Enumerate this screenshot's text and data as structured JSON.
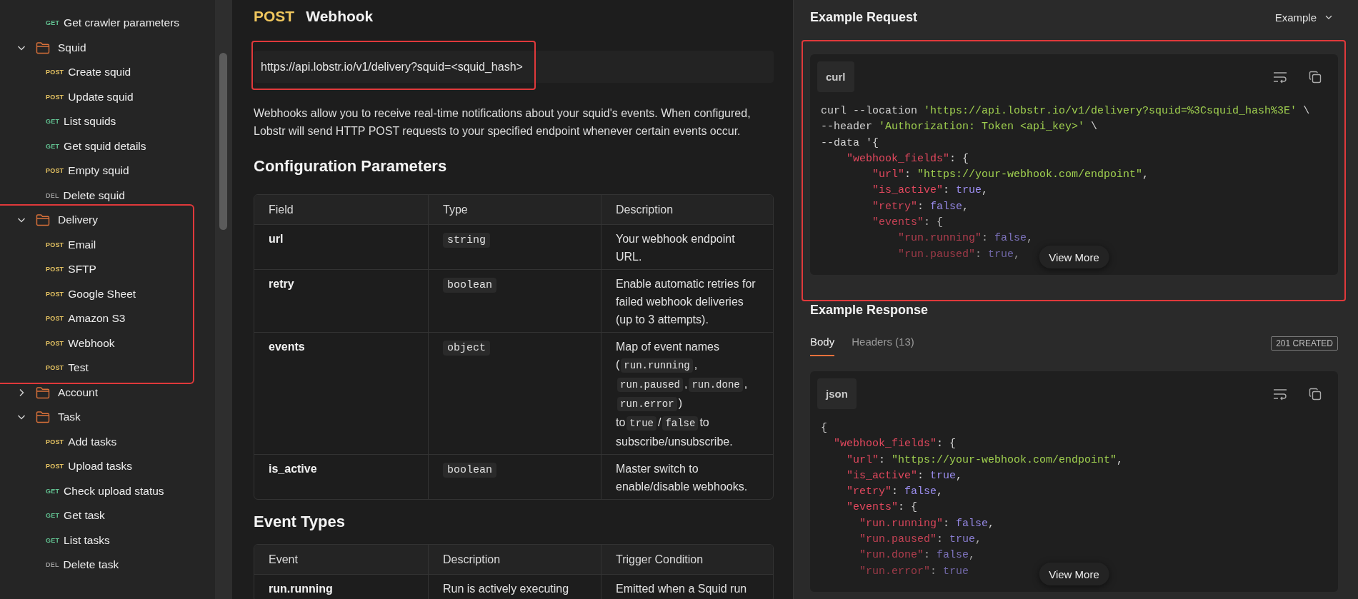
{
  "sidebar": {
    "items": [
      {
        "kind": "get",
        "method": "GET",
        "label": "Get crawler parameters"
      },
      {
        "kind": "folder",
        "label": "Squid",
        "expanded": true,
        "highlighted": false,
        "children": [
          {
            "kind": "post",
            "method": "POST",
            "label": "Create squid"
          },
          {
            "kind": "post",
            "method": "POST",
            "label": "Update squid"
          },
          {
            "kind": "get",
            "method": "GET",
            "label": "List squids"
          },
          {
            "kind": "get",
            "method": "GET",
            "label": "Get squid details"
          },
          {
            "kind": "post",
            "method": "POST",
            "label": "Empty squid"
          },
          {
            "kind": "del",
            "method": "DEL",
            "label": "Delete squid"
          }
        ]
      },
      {
        "kind": "folder",
        "label": "Delivery",
        "expanded": true,
        "highlighted": true,
        "children": [
          {
            "kind": "post",
            "method": "POST",
            "label": "Email"
          },
          {
            "kind": "post",
            "method": "POST",
            "label": "SFTP"
          },
          {
            "kind": "post",
            "method": "POST",
            "label": "Google Sheet"
          },
          {
            "kind": "post",
            "method": "POST",
            "label": "Amazon S3"
          },
          {
            "kind": "post",
            "method": "POST",
            "label": "Webhook"
          },
          {
            "kind": "post",
            "method": "POST",
            "label": "Test"
          }
        ]
      },
      {
        "kind": "folder",
        "label": "Account",
        "expanded": false,
        "highlighted": false
      },
      {
        "kind": "folder",
        "label": "Task",
        "expanded": true,
        "highlighted": false,
        "children": [
          {
            "kind": "post",
            "method": "POST",
            "label": "Add tasks"
          },
          {
            "kind": "post",
            "method": "POST",
            "label": "Upload tasks"
          },
          {
            "kind": "get",
            "method": "GET",
            "label": "Check upload status"
          },
          {
            "kind": "get",
            "method": "GET",
            "label": "Get task"
          },
          {
            "kind": "get",
            "method": "GET",
            "label": "List tasks"
          },
          {
            "kind": "del",
            "method": "DEL",
            "label": "Delete task"
          }
        ]
      }
    ]
  },
  "endpoint": {
    "method": "POST",
    "title": "Webhook"
  },
  "url": {
    "text": "https://api.lobstr.io/v1/delivery?squid=<squid_hash>",
    "highlighted": true
  },
  "intro": "Webhooks allow you to receive real-time notifications about your squid's events. When configured, Lobstr will send HTTP POST requests to your specified endpoint whenever certain events occur.",
  "sections": [
    {
      "heading": "Configuration Parameters",
      "columns": [
        "Field",
        "Type",
        "Description"
      ],
      "rows": [
        [
          {
            "kind": "name",
            "text": "url"
          },
          {
            "kind": "code",
            "text": "string"
          },
          {
            "kind": "text",
            "parts": [
              {
                "kind": "text",
                "text": "Your webhook endpoint URL."
              }
            ]
          }
        ],
        [
          {
            "kind": "name",
            "text": "retry"
          },
          {
            "kind": "code",
            "text": "boolean"
          },
          {
            "kind": "text",
            "parts": [
              {
                "kind": "text",
                "text": "Enable automatic retries for failed webhook deliveries (up to 3 attempts)."
              }
            ]
          }
        ],
        [
          {
            "kind": "name",
            "text": "events"
          },
          {
            "kind": "code",
            "text": "object"
          },
          {
            "kind": "text",
            "parts": [
              {
                "kind": "text",
                "text": "Map of event names ("
              },
              {
                "kind": "code",
                "text": "run.running"
              },
              {
                "kind": "text",
                "text": ","
              },
              {
                "kind": "code",
                "text": "run.paused"
              },
              {
                "kind": "text",
                "text": ","
              },
              {
                "kind": "code",
                "text": "run.done"
              },
              {
                "kind": "text",
                "text": ","
              },
              {
                "kind": "code",
                "text": "run.error"
              },
              {
                "kind": "text",
                "text": ") to"
              },
              {
                "kind": "code",
                "text": "true"
              },
              {
                "kind": "text",
                "text": "/"
              },
              {
                "kind": "code",
                "text": "false"
              },
              {
                "kind": "text",
                "text": "to subscribe/unsubscribe."
              }
            ]
          }
        ],
        [
          {
            "kind": "name",
            "text": "is_active"
          },
          {
            "kind": "code",
            "text": "boolean"
          },
          {
            "kind": "text",
            "parts": [
              {
                "kind": "text",
                "text": "Master switch to enable/disable webhooks."
              }
            ]
          }
        ]
      ]
    },
    {
      "heading": "Event Types",
      "columns": [
        "Event",
        "Description",
        "Trigger Condition"
      ],
      "rows": [
        [
          {
            "kind": "name",
            "text": "run.running"
          },
          {
            "kind": "text",
            "parts": [
              {
                "kind": "text",
                "text": "Run is actively executing"
              }
            ]
          },
          {
            "kind": "text",
            "parts": [
              {
                "kind": "text",
                "text": "Emitted when a Squid run"
              }
            ]
          }
        ]
      ]
    }
  ],
  "example_request": {
    "heading": "Example Request",
    "selector": "Example",
    "highlighted": true,
    "language": "curl",
    "view_more": "View More",
    "lines": [
      [
        {
          "kind": "plain",
          "text": "curl --location "
        },
        {
          "kind": "string",
          "text": "'https://api.lobstr.io/v1/delivery?squid=%3Csquid_hash%3E'"
        },
        {
          "kind": "plain",
          "text": " \\"
        }
      ],
      [
        {
          "kind": "plain",
          "text": "--header "
        },
        {
          "kind": "string",
          "text": "'Authorization: Token <api_key>'"
        },
        {
          "kind": "plain",
          "text": " \\"
        }
      ],
      [
        {
          "kind": "plain",
          "text": "--data '{"
        }
      ],
      [
        {
          "kind": "key",
          "text": "    \"webhook_fields\""
        },
        {
          "kind": "plain",
          "text": ": {"
        }
      ],
      [
        {
          "kind": "key",
          "text": "        \"url\""
        },
        {
          "kind": "plain",
          "text": ": "
        },
        {
          "kind": "string",
          "text": "\"https://your-webhook.com/endpoint\""
        },
        {
          "kind": "plain",
          "text": ","
        }
      ],
      [
        {
          "kind": "key",
          "text": "        \"is_active\""
        },
        {
          "kind": "plain",
          "text": ": "
        },
        {
          "kind": "literal",
          "text": "true"
        },
        {
          "kind": "plain",
          "text": ","
        }
      ],
      [
        {
          "kind": "key",
          "text": "        \"retry\""
        },
        {
          "kind": "plain",
          "text": ": "
        },
        {
          "kind": "literal",
          "text": "false"
        },
        {
          "kind": "plain",
          "text": ","
        }
      ],
      [
        {
          "kind": "key",
          "text": "        \"events\""
        },
        {
          "kind": "plain",
          "text": ": {"
        }
      ],
      [
        {
          "kind": "key",
          "text": "            \"run.running\""
        },
        {
          "kind": "plain",
          "text": ": "
        },
        {
          "kind": "literal",
          "text": "false"
        },
        {
          "kind": "plain",
          "text": ","
        }
      ],
      [
        {
          "kind": "key",
          "text": "            \"run.paused\""
        },
        {
          "kind": "plain",
          "text": ": "
        },
        {
          "kind": "literal",
          "text": "true"
        },
        {
          "kind": "plain",
          "text": ","
        }
      ]
    ]
  },
  "example_response": {
    "heading": "Example Response",
    "tabs": [
      {
        "label": "Body",
        "selected": true
      },
      {
        "label": "Headers (13)",
        "selected": false
      }
    ],
    "status": "201 CREATED",
    "language": "json",
    "view_more": "View More",
    "lines": [
      [
        {
          "kind": "plain",
          "text": "{"
        }
      ],
      [
        {
          "kind": "key",
          "text": "  \"webhook_fields\""
        },
        {
          "kind": "plain",
          "text": ": {"
        }
      ],
      [
        {
          "kind": "key",
          "text": "    \"url\""
        },
        {
          "kind": "plain",
          "text": ": "
        },
        {
          "kind": "string",
          "text": "\"https://your-webhook.com/endpoint\""
        },
        {
          "kind": "plain",
          "text": ","
        }
      ],
      [
        {
          "kind": "key",
          "text": "    \"is_active\""
        },
        {
          "kind": "plain",
          "text": ": "
        },
        {
          "kind": "literal",
          "text": "true"
        },
        {
          "kind": "plain",
          "text": ","
        }
      ],
      [
        {
          "kind": "key",
          "text": "    \"retry\""
        },
        {
          "kind": "plain",
          "text": ": "
        },
        {
          "kind": "literal",
          "text": "false"
        },
        {
          "kind": "plain",
          "text": ","
        }
      ],
      [
        {
          "kind": "key",
          "text": "    \"events\""
        },
        {
          "kind": "plain",
          "text": ": {"
        }
      ],
      [
        {
          "kind": "key",
          "text": "      \"run.running\""
        },
        {
          "kind": "plain",
          "text": ": "
        },
        {
          "kind": "literal",
          "text": "false"
        },
        {
          "kind": "plain",
          "text": ","
        }
      ],
      [
        {
          "kind": "key",
          "text": "      \"run.paused\""
        },
        {
          "kind": "plain",
          "text": ": "
        },
        {
          "kind": "literal",
          "text": "true"
        },
        {
          "kind": "plain",
          "text": ","
        }
      ],
      [
        {
          "kind": "key",
          "text": "      \"run.done\""
        },
        {
          "kind": "plain",
          "text": ": "
        },
        {
          "kind": "literal",
          "text": "false"
        },
        {
          "kind": "plain",
          "text": ","
        }
      ],
      [
        {
          "kind": "key",
          "text": "      \"run.error\""
        },
        {
          "kind": "plain",
          "text": ": "
        },
        {
          "kind": "literal",
          "text": "true"
        }
      ]
    ]
  }
}
